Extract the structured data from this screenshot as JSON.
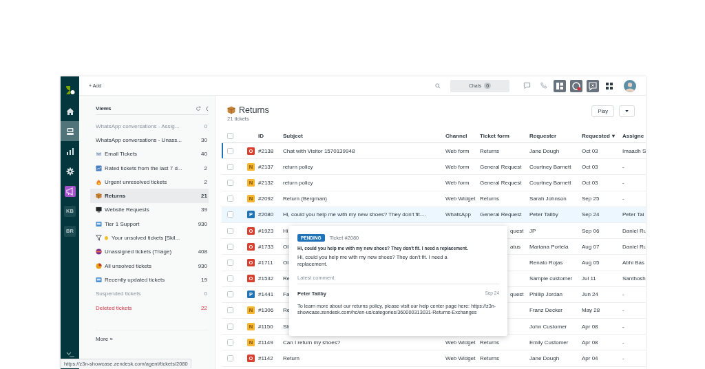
{
  "nav": {
    "items": [
      {
        "kind": "home",
        "selected": false
      },
      {
        "kind": "views",
        "selected": true
      },
      {
        "kind": "reports",
        "selected": false
      },
      {
        "kind": "settings",
        "selected": false
      },
      {
        "kind": "megaphone",
        "selected": false
      },
      {
        "kind": "app",
        "label": "KB",
        "selected": false
      },
      {
        "kind": "app",
        "label": "BR",
        "selected": false
      }
    ]
  },
  "topbar": {
    "add_label": "+ Add",
    "chats": {
      "label": "Chats",
      "count": "0"
    }
  },
  "views": {
    "title": "Views",
    "items": [
      {
        "label": "WhatsApp conversations - Assig...",
        "count": "0",
        "kind": "muted",
        "selected": false
      },
      {
        "label": "WhatsApp conversations - Unass...",
        "count": "30",
        "kind": "normal",
        "selected": false
      },
      {
        "label": "Email Tickets",
        "count": "40",
        "kind": "normal",
        "selected": false
      },
      {
        "label": "Rated tickets from the last 7 d...",
        "count": "2",
        "kind": "normal",
        "selected": false
      },
      {
        "label": "Urgent unresolved tickets",
        "count": "2",
        "kind": "normal",
        "selected": false
      },
      {
        "label": "Returns",
        "count": "21",
        "kind": "normal",
        "selected": true
      },
      {
        "label": "Website Requests",
        "count": "39",
        "kind": "normal",
        "selected": false
      },
      {
        "label": "Tier 1 Support",
        "count": "930",
        "kind": "normal",
        "selected": false
      },
      {
        "label": "Your unsolved tickets [Skil...",
        "kind": "normal",
        "selected": false
      },
      {
        "label": "Unassigned tickets (Triage)",
        "count": "408",
        "kind": "normal",
        "selected": false
      },
      {
        "label": "All unsolved tickets",
        "count": "930",
        "kind": "normal",
        "selected": false
      },
      {
        "label": "Recently updated tickets",
        "count": "19",
        "kind": "normal",
        "selected": false
      },
      {
        "label": "Suspended tickets",
        "count": "0",
        "kind": "muted",
        "selected": false
      },
      {
        "label": "Deleted tickets",
        "count": "22",
        "kind": "deleted",
        "selected": false
      }
    ],
    "more": "More »"
  },
  "main": {
    "title": "Returns",
    "subtitle": "21 tickets",
    "play": "Play"
  },
  "table": {
    "header_checked": false,
    "columns": [
      {
        "label": "ID"
      },
      {
        "label": "Subject"
      },
      {
        "label": "Channel"
      },
      {
        "label": "Ticket form"
      },
      {
        "label": "Requester"
      },
      {
        "label": "Requested",
        "sort_indicator": "▾"
      },
      {
        "label": "Assigne"
      }
    ],
    "rows": [
      {
        "checked": false,
        "selected": false,
        "focused": true,
        "status": "O",
        "color": "#d93f2f",
        "cells": {
          "id": "#2138",
          "subject": "Chat with Visitor 1570139948",
          "channel": "Web form",
          "ticket_form": "Returns",
          "requester": "Jane Dough",
          "requested": "Oct 03",
          "assignee": "Imaadh S"
        }
      },
      {
        "checked": false,
        "selected": false,
        "focused": false,
        "status": "N",
        "color": "#f5b731",
        "cells": {
          "id": "#2137",
          "subject": "return policy",
          "channel": "Web form",
          "ticket_form": "General Request",
          "requester": "Courtney Barnett",
          "requested": "Oct 03",
          "assignee": "-"
        }
      },
      {
        "checked": false,
        "selected": false,
        "focused": false,
        "status": "N",
        "color": "#f5b731",
        "cells": {
          "id": "#2132",
          "subject": "return policy",
          "channel": "Web form",
          "ticket_form": "General Request",
          "requester": "Courtney Barnett",
          "requested": "Oct 03",
          "assignee": "-"
        }
      },
      {
        "checked": false,
        "selected": false,
        "focused": false,
        "status": "N",
        "color": "#f5b731",
        "cells": {
          "id": "#2092",
          "subject": "Return (Bergman)",
          "channel": "Web Widget",
          "ticket_form": "Returns",
          "requester": "Sarah Johnson",
          "requested": "Sep 25",
          "assignee": "-"
        }
      },
      {
        "checked": false,
        "selected": true,
        "focused": false,
        "status": "P",
        "color": "#1f73b7",
        "cells": {
          "id": "#2080",
          "subject": "Hi, could you help me with my new shoes? They don't fit....",
          "channel": "WhatsApp",
          "ticket_form": "General Request",
          "requester": "Peter Tailby",
          "requested": "Sep 24",
          "assignee": "Peter Tai"
        }
      },
      {
        "checked": false,
        "selected": false,
        "focused": false,
        "status": "O",
        "color": "#d93f2f",
        "cells": {
          "id": "#1923",
          "subject": "Hi",
          "ticket_form": "quest",
          "requester": "JP",
          "requested": "Sep 06",
          "assignee": "Daniel Ru"
        }
      },
      {
        "checked": false,
        "selected": false,
        "focused": false,
        "status": "O",
        "color": "#d93f2f",
        "cells": {
          "id": "#1733",
          "subject": "Ol",
          "ticket_form": "atus",
          "requester": "Mariana Portela",
          "requested": "Aug 07",
          "assignee": "Daniel Ru"
        }
      },
      {
        "checked": false,
        "selected": false,
        "focused": false,
        "status": "O",
        "color": "#d93f2f",
        "cells": {
          "id": "#1711",
          "subject": "Ol",
          "requester": "Renato Rojas",
          "requested": "Aug 05",
          "assignee": "Abhi Bas"
        }
      },
      {
        "checked": false,
        "selected": false,
        "focused": false,
        "status": "O",
        "color": "#d93f2f",
        "cells": {
          "id": "#1532",
          "subject": "Re",
          "requester": "Sample customer",
          "requested": "Jul 11",
          "assignee": "Santhosh"
        }
      },
      {
        "checked": false,
        "selected": false,
        "focused": false,
        "status": "P",
        "color": "#1f73b7",
        "cells": {
          "id": "#1441",
          "subject": "Fa",
          "ticket_form": "quest",
          "requester": "Phillip Jordan",
          "requested": "Jun 24",
          "assignee": "-"
        }
      },
      {
        "checked": false,
        "selected": false,
        "focused": false,
        "status": "N",
        "color": "#f5b731",
        "cells": {
          "id": "#1306",
          "subject": "Re",
          "requester": "Franz Decker",
          "requested": "May 28",
          "assignee": "-"
        }
      },
      {
        "checked": false,
        "selected": false,
        "focused": false,
        "status": "N",
        "color": "#f5b731",
        "cells": {
          "id": "#1150",
          "subject": "Sh",
          "requester": "John Customer",
          "requested": "Apr 08",
          "assignee": "-"
        }
      },
      {
        "checked": false,
        "selected": false,
        "focused": false,
        "status": "N",
        "color": "#f5b731",
        "cells": {
          "id": "#1149",
          "subject": "Can I return my shoes?",
          "channel": "Web Widget",
          "ticket_form": "Returns",
          "requester": "Emily Customer",
          "requested": "Apr 08",
          "assignee": "-"
        }
      },
      {
        "checked": false,
        "selected": false,
        "focused": false,
        "status": "O",
        "color": "#d93f2f",
        "cells": {
          "id": "#1142",
          "subject": "Return",
          "channel": "Web Widget",
          "ticket_form": "Returns",
          "requester": "Jane Dough",
          "requested": "Apr 04",
          "assignee": "-"
        }
      }
    ]
  },
  "popover": {
    "status": "PENDING",
    "ticket": "Ticket #2080",
    "subject": "Hi, could you help me with my new shoes? They don't fit. I need a replacement.",
    "description": "Hi, could you help me with my new shoes? They don't fit. I need a replacement.",
    "latest_label": "Latest comment",
    "author": "Peter Tailby",
    "date": "Sep 24",
    "comment": "To learn more about our returns policy, please visit our help center page here: https://z3n-showcase.zendesk.com/hc/en-us/categories/360000313031-Returns-Exchanges"
  },
  "status_bar": {
    "url": "https://z3n-showcase.zendesk.com/agent/tickets/2080"
  }
}
